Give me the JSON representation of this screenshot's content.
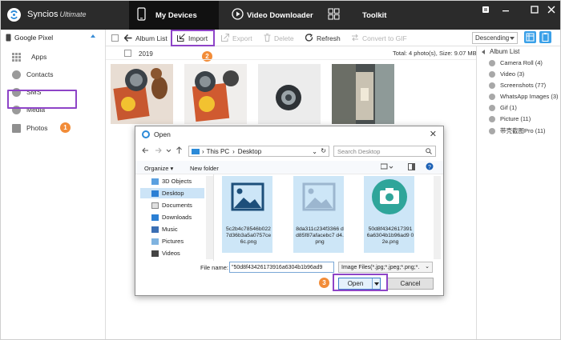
{
  "app": {
    "name": "Syncios",
    "edition": "Ultimate"
  },
  "nav": {
    "tabs": [
      {
        "label": "My Devices",
        "icon": "phone-icon",
        "active": true
      },
      {
        "label": "Video Downloader",
        "icon": "play-icon",
        "active": false
      },
      {
        "label": "Toolkit",
        "icon": "grid-icon",
        "active": false
      }
    ]
  },
  "window_controls": [
    "menu-icon",
    "minimize-icon",
    "maximize-icon",
    "close-icon"
  ],
  "sidebar": {
    "device": "Google Pixel",
    "items": [
      {
        "label": "Apps",
        "icon": "apps-icon"
      },
      {
        "label": "Contacts",
        "icon": "contacts-icon"
      },
      {
        "label": "SMS",
        "icon": "sms-icon"
      },
      {
        "label": "Media",
        "icon": "media-icon"
      },
      {
        "label": "Photos",
        "icon": "photos-icon",
        "selected": true
      }
    ]
  },
  "toolbar": {
    "album_list": "Album List",
    "import": "Import",
    "export": "Export",
    "delete": "Delete",
    "refresh": "Refresh",
    "convert": "Convert to GIF",
    "sort": "Descending"
  },
  "content": {
    "year": "2019",
    "total": "Total: 4 photo(s), Size: 9.07 MB"
  },
  "albums": {
    "title": "Album List",
    "items": [
      "Camera Roll (4)",
      "Video (3)",
      "Screenshots (77)",
      "WhatsApp Images (3)",
      "Gif (1)",
      "Picture (11)",
      "带壳截图Pro (11)"
    ]
  },
  "steps": [
    "1",
    "2",
    "3"
  ],
  "dialog": {
    "title": "Open",
    "path": [
      "This PC",
      "Desktop"
    ],
    "search_placeholder": "Search Desktop",
    "organize": "Organize",
    "new_folder": "New folder",
    "tree": [
      "3D Objects",
      "Desktop",
      "Documents",
      "Downloads",
      "Music",
      "Pictures",
      "Videos"
    ],
    "files": [
      "5c2b4c78546b022 7d36b3a5a0757ce 6c.png",
      "8da311c234f3366 dd85f87afacebc7 d4.png",
      "50d8f4342617391 6a6304b1b96ad9 02e.png"
    ],
    "file_name_label": "File name:",
    "file_name_value": "\"50d8f43426173916a6304b1b96ad9",
    "file_type": "Image Files(*.jpg;*.jpeg;*.png;*.",
    "open": "Open",
    "cancel": "Cancel"
  },
  "colors": {
    "titlebar": "#2b2b2b",
    "highlight_box": "#8e44c7",
    "step_badge": "#f28c38",
    "accent_blue": "#3a8dd6"
  }
}
